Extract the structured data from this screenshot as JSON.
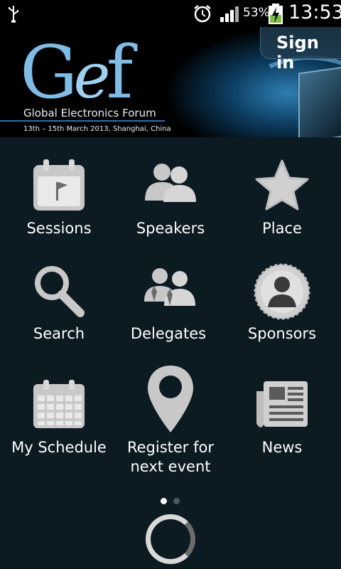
{
  "status_bar": {
    "battery_percent": "53%",
    "time": "13:53",
    "icons": [
      "usb-icon",
      "alarm-icon",
      "signal-icon",
      "battery-charging-icon"
    ]
  },
  "banner": {
    "logo": "Gef",
    "forum_name": "Global Electronics Forum",
    "event_details": "13th – 15th March 2013, Shanghai, China",
    "sign_in_label": "Sign in"
  },
  "menu": {
    "items": [
      {
        "label": "Sessions",
        "icon": "calendar-flag-icon"
      },
      {
        "label": "Speakers",
        "icon": "people-icon"
      },
      {
        "label": "Place",
        "icon": "star-icon"
      },
      {
        "label": "Search",
        "icon": "magnifier-icon"
      },
      {
        "label": "Delegates",
        "icon": "delegates-icon"
      },
      {
        "label": "Sponsors",
        "icon": "sponsor-badge-icon"
      },
      {
        "label": "My Schedule",
        "icon": "calendar-grid-icon"
      },
      {
        "label": "Register for next event",
        "icon": "map-pin-icon"
      },
      {
        "label": "News",
        "icon": "newspaper-icon"
      }
    ]
  },
  "pager": {
    "current_page": 1,
    "total_pages": 2
  },
  "colors": {
    "background": "#0c1a22",
    "accent": "#7fbde6",
    "icon_gray": "#c8c8c8"
  }
}
